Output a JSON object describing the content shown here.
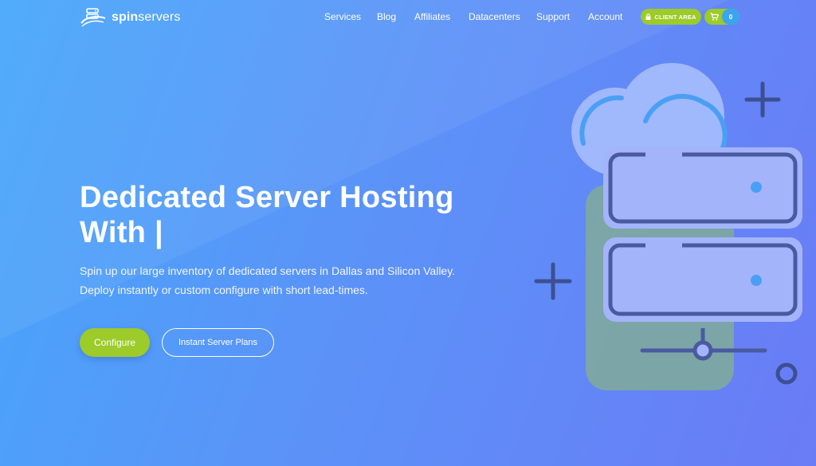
{
  "header": {
    "logo": {
      "bold": "spin",
      "light": "servers",
      "icon": "server-swoosh-logo-icon"
    },
    "nav": [
      {
        "label": "Services"
      },
      {
        "label": "Blog"
      },
      {
        "label": "Affiliates"
      },
      {
        "label": "Datacenters"
      },
      {
        "label": "Support"
      },
      {
        "label": "Account"
      }
    ],
    "client_area": {
      "label": "CLIENT AREA",
      "icon": "lock-icon"
    },
    "cart": {
      "icon": "cart-icon",
      "count": "0"
    }
  },
  "hero": {
    "title_line1": "Dedicated Server Hosting",
    "title_line2": "With |",
    "description_line1": "Spin up our large inventory of dedicated servers in Dallas and Silicon Valley.",
    "description_line2": "Deploy instantly or custom configure with short lead-times.",
    "primary_button": "Configure",
    "secondary_button": "Instant Server Plans"
  },
  "illustration": {
    "icon": "cloud-server-rack-icon"
  },
  "colors": {
    "accent_green": "#9ccb2a",
    "cart_badge_blue": "#3aa4ef",
    "bg_start": "#46a7fb",
    "bg_end": "#6a7bf6"
  }
}
